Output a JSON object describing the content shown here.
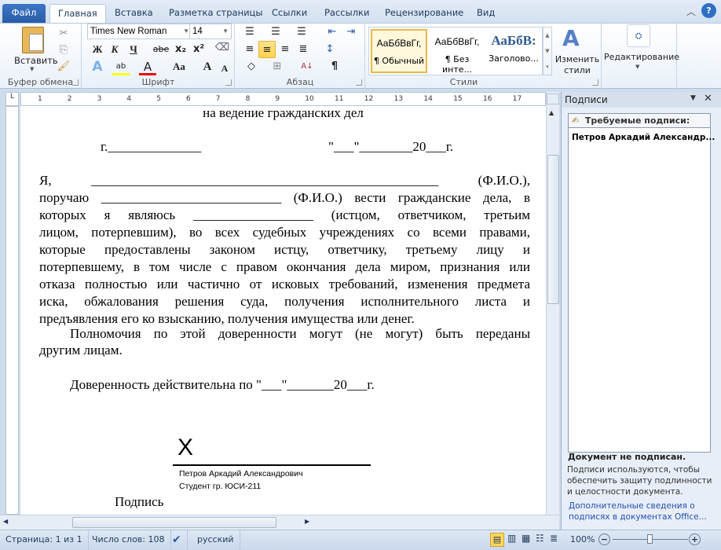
{
  "tabs": [
    "Файл",
    "Главная",
    "Вставка",
    "Разметка страницы",
    "Ссылки",
    "Рассылки",
    "Рецензирование",
    "Вид"
  ],
  "ribbon": {
    "clipboard": {
      "paste": "Вставить",
      "label": "Буфер обмена"
    },
    "font": {
      "name": "Times New Roman",
      "size": "14",
      "bold": "Ж",
      "italic": "К",
      "underline": "Ч",
      "strike": "abe",
      "sub": "x₂",
      "sup": "x²",
      "aa": "Aa",
      "grow": "A",
      "shrink": "A",
      "label": "Шрифт"
    },
    "paragraph": {
      "label": "Абзац",
      "pilcrow": "¶"
    },
    "styles": {
      "items": [
        {
          "sample": "АаБбВвГг,",
          "name": "¶ Обычный"
        },
        {
          "sample": "АаБбВвГг,",
          "name": "¶ Без инте..."
        },
        {
          "sample": "АаБбВ:",
          "name": "Заголово..."
        }
      ],
      "change": "Изменить",
      "change2": "стили",
      "label": "Стили"
    },
    "editing": {
      "label": "Редактирование"
    }
  },
  "ruler_ticks": [
    "1",
    "2",
    "3",
    "4",
    "5",
    "6",
    "7",
    "8",
    "9",
    "10",
    "11",
    "12",
    "13",
    "14",
    "15",
    "16",
    "17"
  ],
  "document": {
    "heading": "на ведение гражданских дел",
    "city": "г.______________",
    "date": "\"___\"________20___г.",
    "para1": [
      "Я, ____________________________________________________ (Ф.И.О.),",
      "поручаю ___________________________ (Ф.И.О.) вести гражданские дела, в",
      "которых я являюсь __________________ (истцом, ответчиком, третьим",
      "лицом, потерпевшим), во всех судебных учреждениях со всеми правами,",
      "которые предоставлены законом истцу, ответчику, третьему лицу и",
      "потерпевшему, в том числе с правом окончания дела миром, признания или",
      "отказа полностью или частично от исковых требований, изменения предмета",
      "иска, обжалования решения суда, получения исполнительного листа и"
    ],
    "para1_last": "предъявления его ко взысканию, получения имущества или денег.",
    "para2": [
      "Полномочия по этой доверенности могут (не могут) быть переданы"
    ],
    "para2_last": "другим лицам.",
    "validity": "Доверенность действительна по \"___\"_______20___г.",
    "sig_x": "X",
    "sig_name": "Петров Аркадий Александрович",
    "sig_title": "Студент гр. ЮСИ-211",
    "sig_caption": "Подпись"
  },
  "pane": {
    "title": "Подписи",
    "required": "Требуемые подписи:",
    "signer": "Петров Аркадий Александр...",
    "status": "Документ не подписан.",
    "info": "Подписи используются, чтобы обеспечить защиту подлинности и целостности документа.",
    "link": "Дополнительные сведения о подписях в документах Office..."
  },
  "statusbar": {
    "page": "Страница: 1 из 1",
    "words": "Число слов: 108",
    "lang": "русский",
    "zoom": "100%",
    "zoom_value": 100
  }
}
